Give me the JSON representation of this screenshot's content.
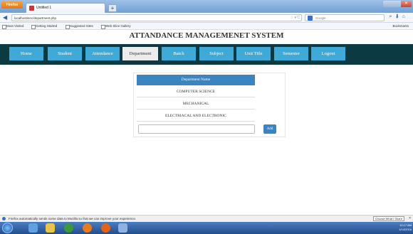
{
  "browser": {
    "menu_button": "Firefox",
    "tab_title": "Untitled 1",
    "new_tab": "+",
    "url": "localhost/enc/department.php",
    "search_placeholder": "Google",
    "bookmarks": [
      "Most Visited",
      "Getting Started",
      "Suggested Sites",
      "Web Slice Gallery"
    ],
    "bookmarks_right": "Bookmarks"
  },
  "page": {
    "title": "ATTANDANCE MANAGEMENET SYSTEM",
    "menu": [
      {
        "label": "Home"
      },
      {
        "label": "Student"
      },
      {
        "label": "Attendance"
      },
      {
        "label": "Department",
        "active": true
      },
      {
        "label": "Batch"
      },
      {
        "label": "Subject"
      },
      {
        "label": "Unit Title"
      },
      {
        "label": "Semester"
      },
      {
        "label": "Logout"
      }
    ],
    "table": {
      "header": "Department Name",
      "rows": [
        "COMPUTER SCIENCE",
        "MECHANICAL",
        "ELECTRIACAL AND ELECTRONIC"
      ]
    },
    "input_value": "",
    "add_label": "Add"
  },
  "notification": {
    "text": "Firefox automatically sends some data to Mozilla so that we can improve your experience.",
    "button": "Choose What I Share",
    "close": "×"
  },
  "taskbar": {
    "time": "11:17 AM",
    "date": "1/14/2016"
  },
  "colors": {
    "menu_bar": "#0c3a42",
    "menu_item": "#3fa9d8",
    "table_header": "#3b84c2"
  }
}
